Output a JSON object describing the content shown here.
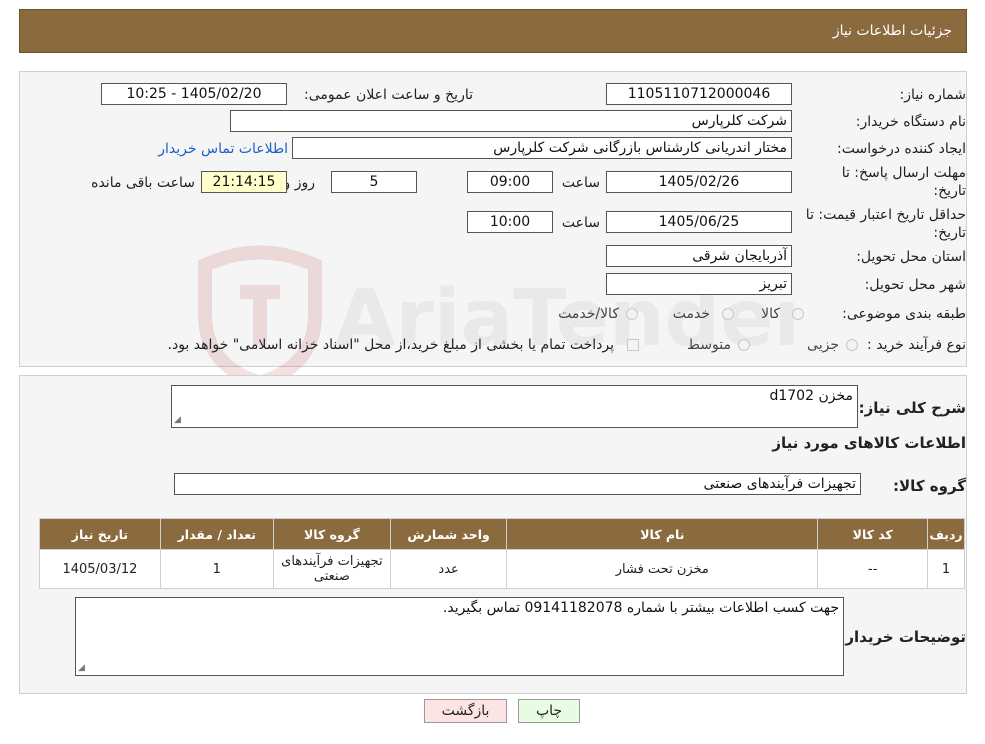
{
  "header": {
    "title": "جزئیات اطلاعات نیاز"
  },
  "form": {
    "need_number_label": "شماره نیاز:",
    "need_number": "1105110712000046",
    "announce_label": "تاریخ و ساعت اعلان عمومی:",
    "announce_value": "1405/02/20 - 10:25",
    "buyer_org_label": "نام دستگاه خریدار:",
    "buyer_org": "شرکت کلرپارس",
    "creator_label": "ایجاد کننده درخواست:",
    "creator": "مختار اندریانی کارشناس بازرگانی شرکت کلرپارس",
    "contact_link": "اطلاعات تماس خریدار",
    "deadline_label_1": "مهلت ارسال پاسخ: تا",
    "deadline_label_2": "تاریخ:",
    "deadline_date": "1405/02/26",
    "time_label": "ساعت",
    "deadline_time": "09:00",
    "days_value": "5",
    "days_label": "روز و",
    "remaining_time": "21:14:15",
    "remaining_label": "ساعت باقی مانده",
    "validity_label_1": "حداقل تاریخ اعتبار قیمت: تا",
    "validity_label_2": "تاریخ:",
    "validity_date": "1405/06/25",
    "validity_time_label": "ساعت",
    "validity_time": "10:00",
    "province_label": "استان محل تحویل:",
    "province": "آذربایجان شرقی",
    "city_label": "شهر محل تحویل:",
    "city": "تبریز",
    "category_label": "طبقه بندی موضوعی:",
    "category_options": [
      "کالا",
      "خدمت",
      "کالا/خدمت"
    ],
    "process_label": "نوع فرآیند خرید :",
    "process_options": [
      "جزیی",
      "متوسط"
    ],
    "payment_note": "پرداخت تمام یا بخشی از مبلغ خرید،از محل \"اسناد خزانه اسلامی\" خواهد بود."
  },
  "details": {
    "summary_label": "شرح کلی نیاز:",
    "summary_value": "مخزن d1702",
    "items_heading": "اطلاعات کالاهای مورد نیاز",
    "group_label": "گروه کالا:",
    "group_value": "تجهیزات فرآیندهای صنعتی",
    "table": {
      "headers": [
        "ردیف",
        "کد کالا",
        "نام کالا",
        "واحد شمارش",
        "گروه کالا",
        "تعداد / مقدار",
        "تاریخ نیاز"
      ],
      "rows": [
        [
          "1",
          "--",
          "مخزن تحت فشار",
          "عدد",
          "تجهیزات فرآیندهای صنعتی",
          "1",
          "1405/03/12"
        ]
      ]
    },
    "buyer_notes_label": "توضیحات خریدار:",
    "buyer_notes_value": "جهت کسب اطلاعات بیشتر با شماره 09141182078 تماس بگیرید."
  },
  "buttons": {
    "print": "چاپ",
    "back": "بازگشت"
  },
  "watermark": {
    "text": "AriaTender.neT"
  },
  "colors": {
    "header_bg": "#8b6a3e",
    "link": "#1a5fc8",
    "remaining_bg": "#ffffcc",
    "back_bg": "#fde4e4",
    "print_bg": "#e8fbe3"
  }
}
